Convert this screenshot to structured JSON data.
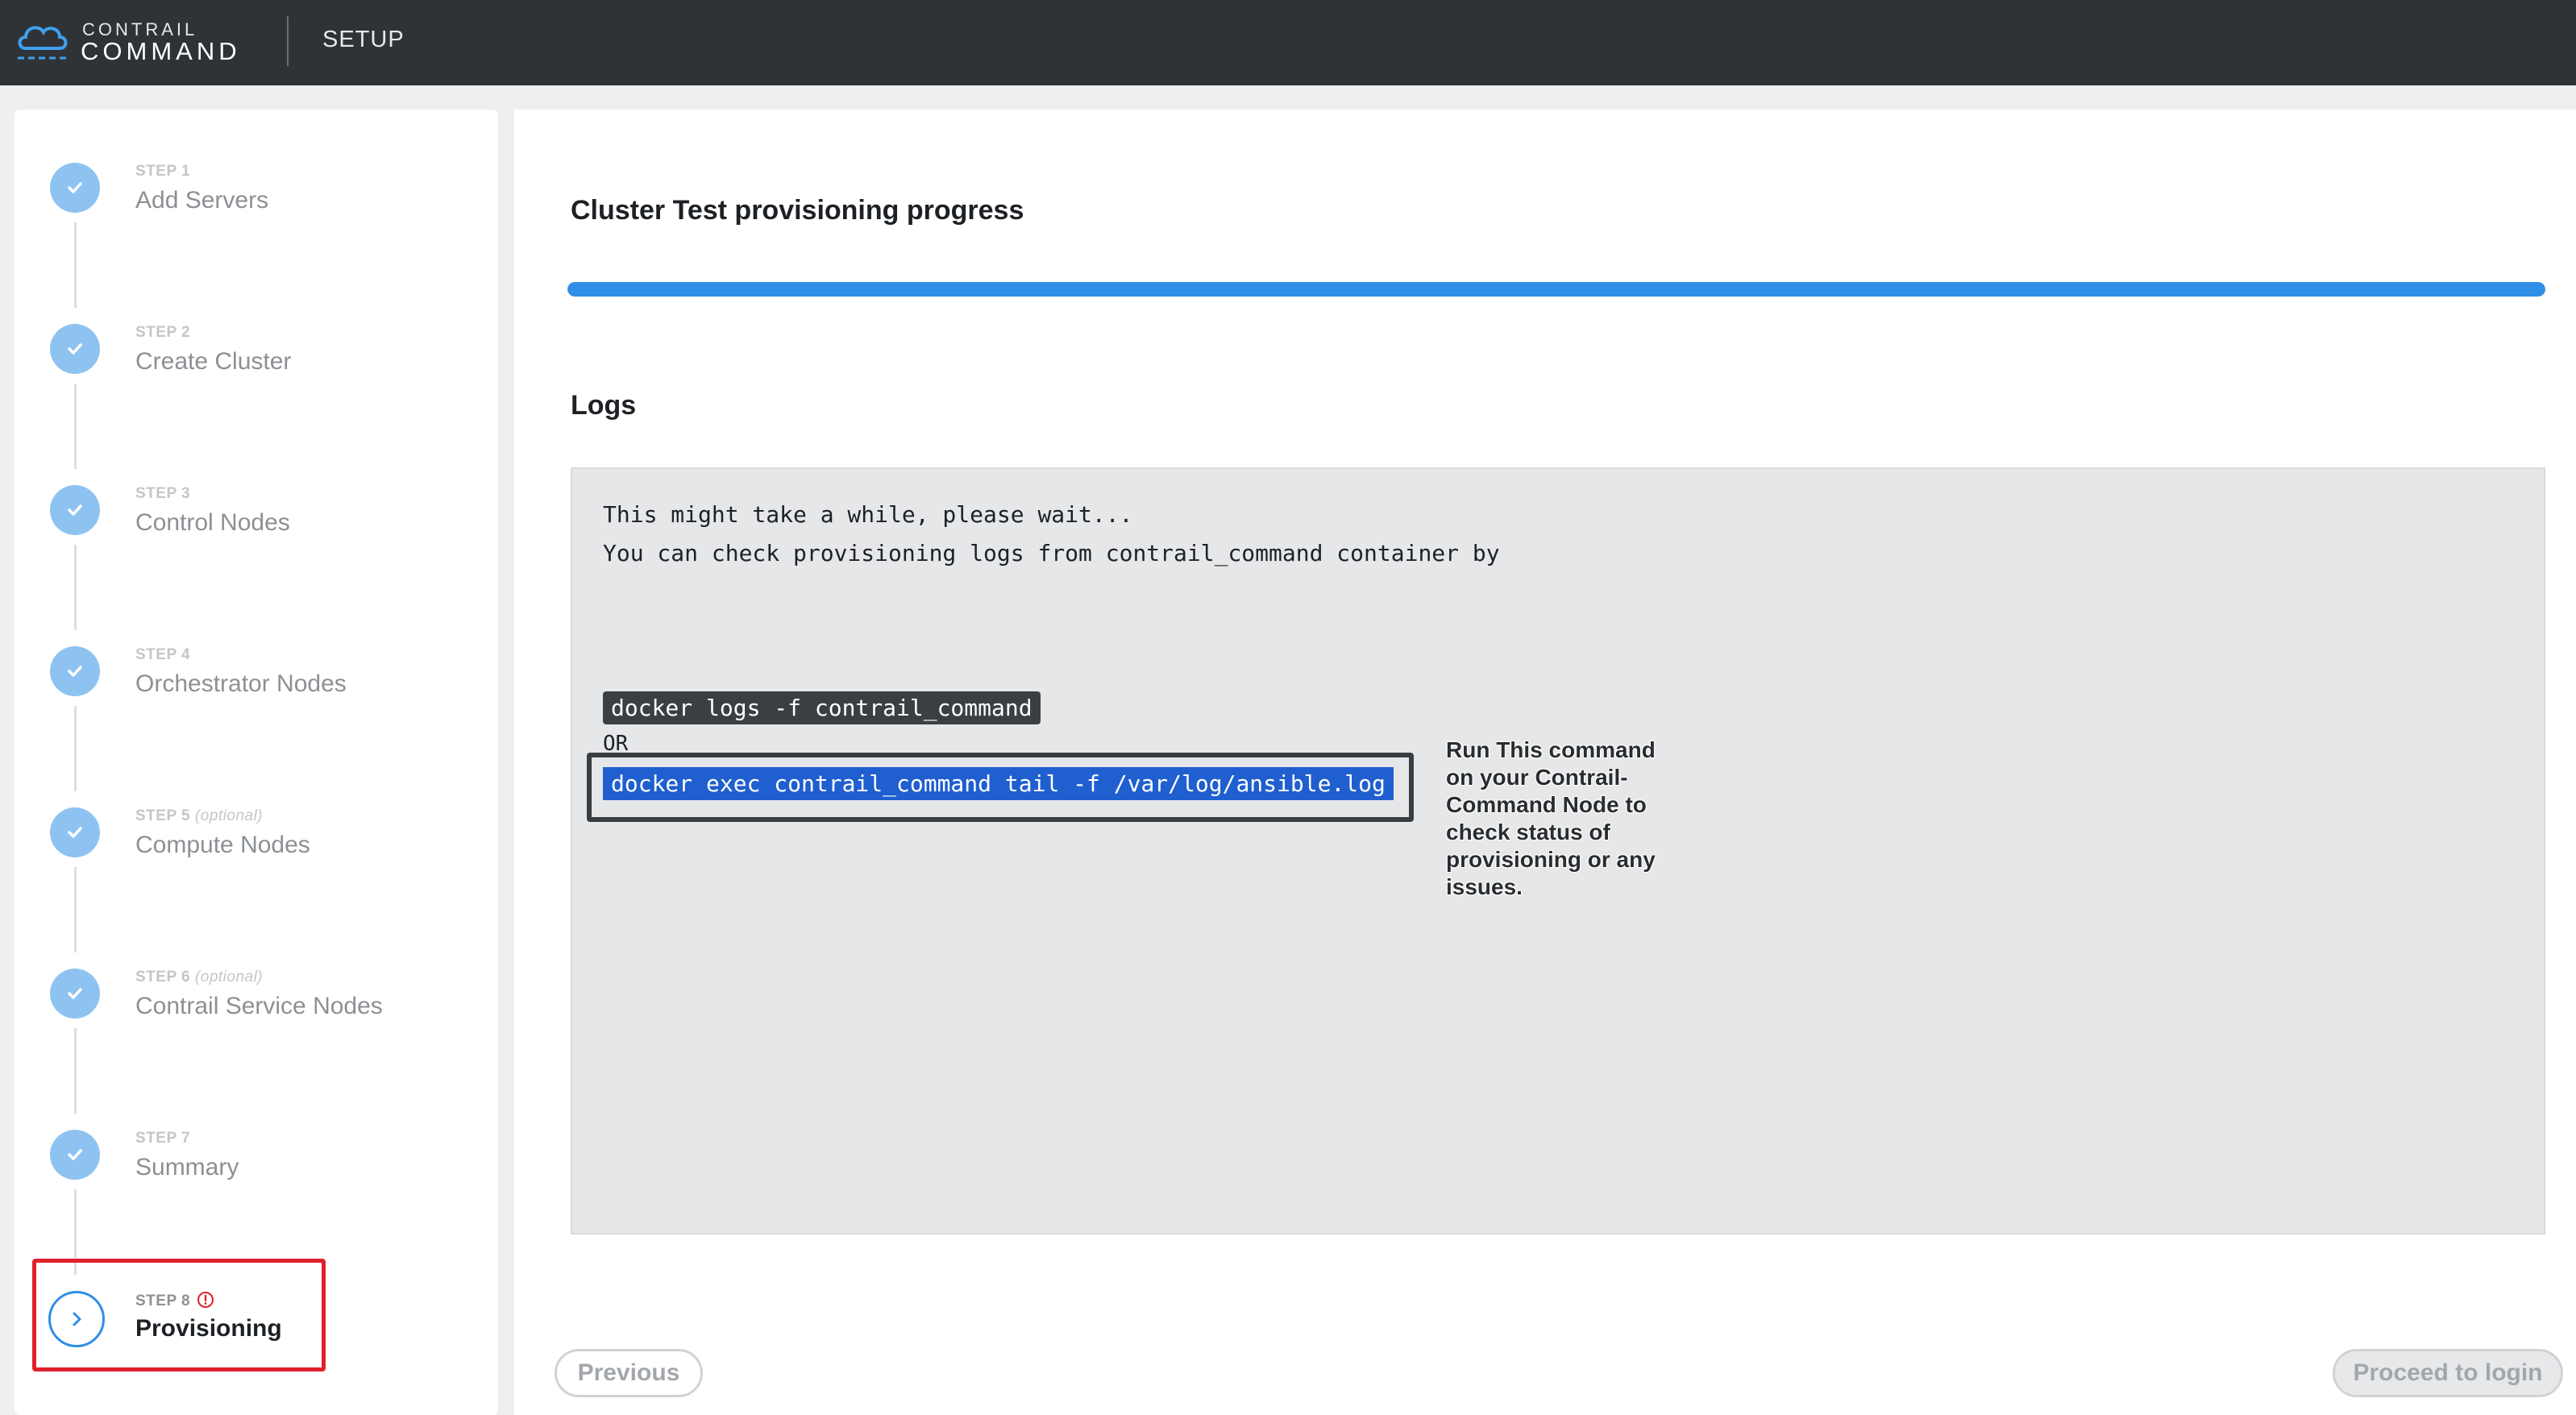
{
  "header": {
    "logo_top": "CONTRAIL",
    "logo_bottom": "COMMAND",
    "section": "SETUP"
  },
  "sidebar": {
    "steps": [
      {
        "number": "STEP 1",
        "optional": "",
        "title": "Add Servers",
        "state": "complete",
        "icon": "check-icon"
      },
      {
        "number": "STEP 2",
        "optional": "",
        "title": "Create Cluster",
        "state": "complete",
        "icon": "check-icon"
      },
      {
        "number": "STEP 3",
        "optional": "",
        "title": "Control Nodes",
        "state": "complete",
        "icon": "check-icon"
      },
      {
        "number": "STEP 4",
        "optional": "",
        "title": "Orchestrator Nodes",
        "state": "complete",
        "icon": "check-icon"
      },
      {
        "number": "STEP 5",
        "optional": "(optional)",
        "title": "Compute Nodes",
        "state": "complete",
        "icon": "check-icon"
      },
      {
        "number": "STEP 6",
        "optional": "(optional)",
        "title": "Contrail Service Nodes",
        "state": "complete",
        "icon": "check-icon"
      },
      {
        "number": "STEP 7",
        "optional": "",
        "title": "Summary",
        "state": "complete",
        "icon": "check-icon"
      },
      {
        "number": "STEP 8",
        "optional": "",
        "title": "Provisioning",
        "state": "active",
        "icon": "chevron-right-icon",
        "badge_icon": "warning-icon"
      }
    ]
  },
  "main": {
    "progress_title": "Cluster Test provisioning progress",
    "progress_fraction": 1.0,
    "logs_title": "Logs",
    "logs": {
      "line1": "This might take a while, please wait...",
      "line2": "You can check provisioning logs from contrail_command container by",
      "command1": "docker logs -f contrail_command",
      "or": "OR",
      "command2": "docker exec contrail_command tail -f /var/log/ansible.log"
    },
    "callout_note": "Run This command on your Contrail-Command Node to check status of provisioning or any issues."
  },
  "footer": {
    "previous_label": "Previous",
    "proceed_label": "Proceed to login"
  },
  "colors": {
    "topbar": "#2f3337",
    "accent": "#2f8fe6",
    "step_done": "#8ec3f1",
    "highlight": "#e0202a"
  }
}
